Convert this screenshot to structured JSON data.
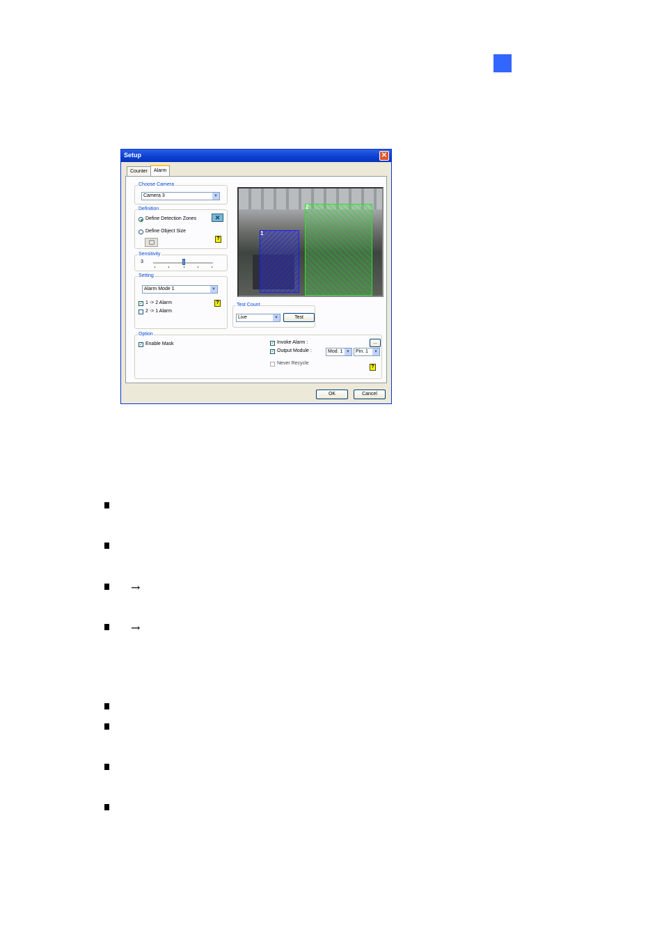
{
  "page": {
    "arrow_glyph": "→"
  },
  "dialog": {
    "title": "Setup",
    "close_glyph": "✕",
    "tabs": [
      {
        "label": "Counter"
      },
      {
        "label": "Alarm"
      }
    ],
    "choose_camera": {
      "label": "Choose Camera",
      "value": "Camera 3"
    },
    "definition": {
      "label": "Definition",
      "opt_zones": "Define Detection Zones",
      "opt_size": "Define Object Size"
    },
    "sensitivity": {
      "label": "Sensitivity",
      "value": "3"
    },
    "setting": {
      "label": "Setting",
      "mode": "Alarm Mode 1",
      "alarm_1_2": "1 -> 2 Alarm",
      "alarm_2_1": "2 -> 1 Alarm"
    },
    "preview": {
      "zone1": "1",
      "zone2": "2"
    },
    "test_count": {
      "label": "Test Count",
      "source": "Live",
      "button": "Test"
    },
    "option": {
      "label": "Option",
      "enable_mask": "Enable Mask",
      "invoke_alarm": "Invoke Alarm :",
      "output_module": "Output Module :",
      "never_recycle": "Never Recycle",
      "module": "Mod. 1",
      "pin": "Pin. 1",
      "browse": "..."
    },
    "ok": "OK",
    "cancel": "Cancel"
  },
  "colors": {
    "accent": "#3366ff",
    "zone1": "#2a2ad0",
    "zone2": "#3cd23c"
  }
}
